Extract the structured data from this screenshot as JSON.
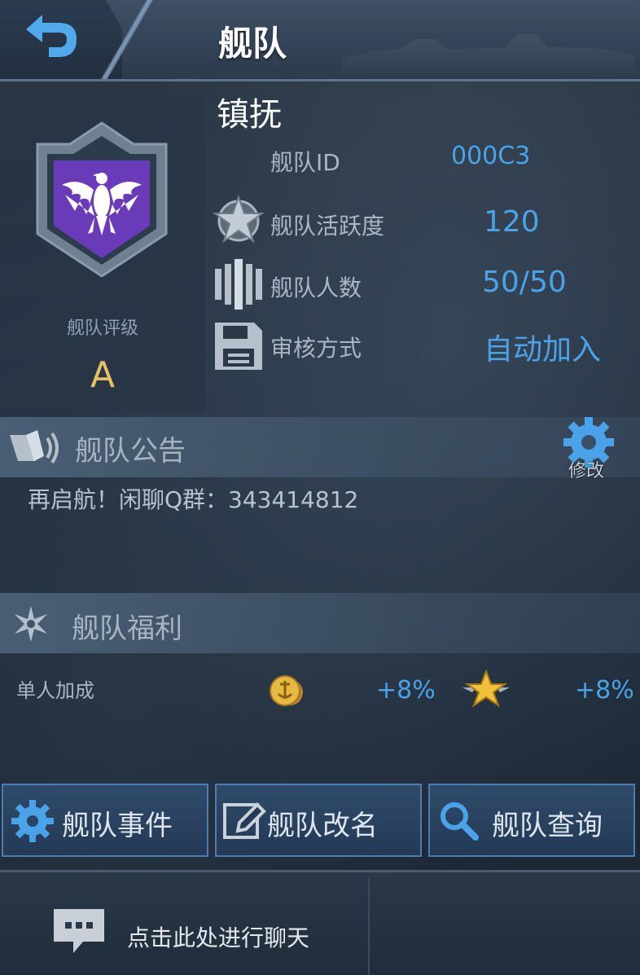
{
  "header": {
    "title": "舰队"
  },
  "fleet": {
    "name": "镇抚",
    "rating_label": "舰队评级",
    "rating_value": "A",
    "id_label": "舰队ID",
    "id_value": "000C3",
    "activity_label": "舰队活跃度",
    "activity_value": "120",
    "members_label": "舰队人数",
    "members_value": "50/50",
    "review_label": "审核方式",
    "review_value": "自动加入"
  },
  "notice": {
    "title": "舰队公告",
    "edit_label": "修改",
    "text": "再启航！闲聊Q群：343414812"
  },
  "welfare": {
    "title": "舰队福利",
    "row_label": "单人加成",
    "coin_bonus": "+8%",
    "star_bonus": "+8%"
  },
  "actions": {
    "events": "舰队事件",
    "rename": "舰队改名",
    "search": "舰队查询"
  },
  "chat": {
    "label": "点击此处进行聊天"
  },
  "colors": {
    "accent_blue": "#4aa3e8",
    "rating_gold": "#e8c063",
    "emblem_purple": "#6a3bb8"
  }
}
